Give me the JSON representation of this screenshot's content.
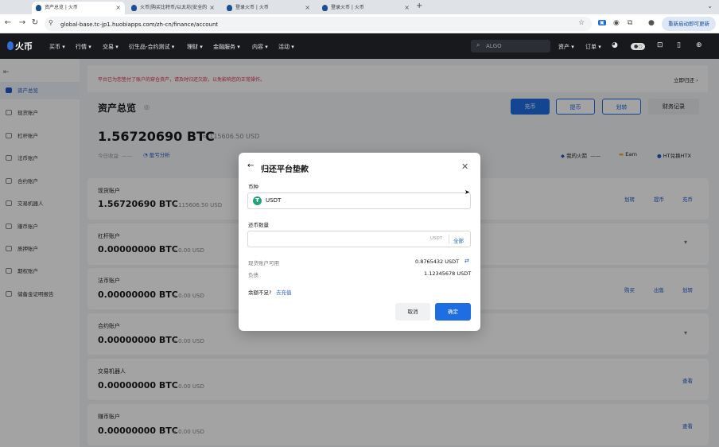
{
  "browser": {
    "tabs": [
      {
        "title": "资产总览 | 火币"
      },
      {
        "title": "火币|购买比特币/以太坊|安全的"
      },
      {
        "title": "登录火币 | 火币"
      },
      {
        "title": "登录火币 | 火币"
      }
    ],
    "new_tab": "+",
    "url": "global-base.tc-jp1.huobiapps.com/zh-cn/finance/account",
    "restart_label": "重新启动即可更新"
  },
  "nav": {
    "logo": "火币",
    "items": [
      "买币",
      "行情",
      "交易",
      "衍生品-合约测试",
      "理财",
      "金融服务",
      "内容",
      "活动"
    ],
    "search_placeholder": "ALGO",
    "assets": "资产",
    "orders": "订单"
  },
  "sidebar": {
    "items": [
      {
        "label": "资产总览"
      },
      {
        "label": "现货账户"
      },
      {
        "label": "杠杆账户"
      },
      {
        "label": "法币账户"
      },
      {
        "label": "合约账户"
      },
      {
        "label": "交易机器人"
      },
      {
        "label": "赚币账户"
      },
      {
        "label": "质押账户"
      },
      {
        "label": "期权账户"
      },
      {
        "label": "储备金证明报告"
      }
    ]
  },
  "notice": {
    "text": "平台已为您垫付了账户的穿仓资产，请及时归还欠款，以免影响您的正常操作。",
    "link": "立即归还 ›"
  },
  "overview": {
    "title": "资产总览",
    "buttons": {
      "deposit": "充币",
      "withdraw": "提币",
      "transfer": "划转",
      "records": "财务记录"
    },
    "balance": "1.56720690 BTC",
    "balance_usd": "≈ 115606.50 USD",
    "today_label": "今日收益",
    "today_value": "——",
    "pnl": "盈亏分析",
    "links": {
      "myvault": "我的火箭",
      "myvault_value": "——",
      "earn": "Earn",
      "htx": "HT兑换HTX"
    }
  },
  "accounts": [
    {
      "name": "现货账户",
      "balance": "1.56720690 BTC",
      "usd": "≈ 115606.50 USD",
      "actions": [
        "划转",
        "提币",
        "充币"
      ]
    },
    {
      "name": "杠杆账户",
      "balance": "0.00000000 BTC",
      "usd": "≈ 0.00 USD",
      "actions": []
    },
    {
      "name": "法币账户",
      "balance": "0.00000000 BTC",
      "usd": "≈ 0.00 USD",
      "actions": [
        "购买",
        "出售",
        "划转"
      ]
    },
    {
      "name": "合约账户",
      "balance": "0.00000000 BTC",
      "usd": "≈ 0.00 USD",
      "actions": []
    },
    {
      "name": "交易机器人",
      "balance": "0.00000000 BTC",
      "usd": "≈ 0.00 USD",
      "actions": [
        "查看"
      ]
    },
    {
      "name": "赚币账户",
      "balance": "0.00000000 BTC",
      "usd": "≈ 0.00 USD",
      "actions": [
        "查看"
      ]
    }
  ],
  "modal": {
    "title": "归还平台垫款",
    "currency_label": "币种",
    "currency_value": "USDT",
    "amount_label": "还币数量",
    "amount_value": "",
    "amount_unit": "USDT",
    "all_label": "全部",
    "available_label": "现货账户可用",
    "available_value": "0.8765432 USDT",
    "debt_label": "负债",
    "debt_value": "1.12345678 USDT",
    "insufficient": "余额不足?",
    "recharge": "去充值",
    "cancel": "取消",
    "confirm": "确定"
  }
}
